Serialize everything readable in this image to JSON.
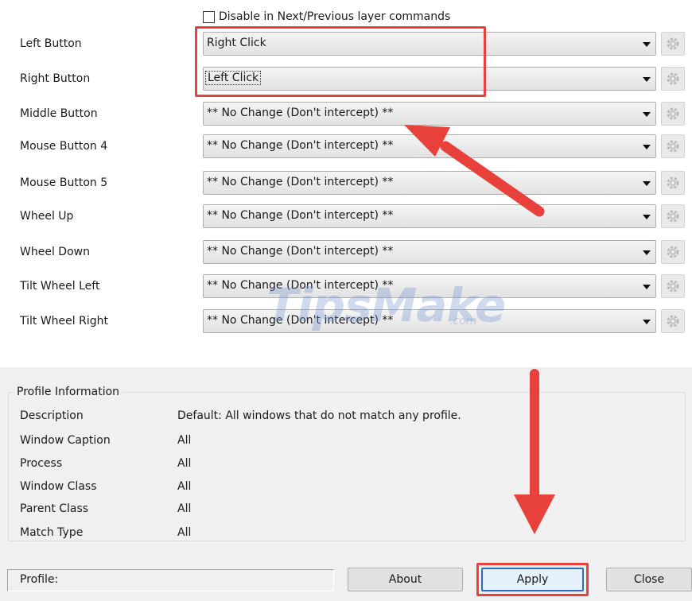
{
  "layer_option": {
    "label": "Disable in Next/Previous layer commands",
    "checked": false
  },
  "button_mappings": [
    {
      "label": "Left Button",
      "value": "Right Click"
    },
    {
      "label": "Right Button",
      "value": "Left Click"
    },
    {
      "label": "Middle Button",
      "value": "** No Change (Don't intercept) **"
    },
    {
      "label": "Mouse Button 4",
      "value": "** No Change (Don't intercept) **"
    },
    {
      "label": "Mouse Button 5",
      "value": "** No Change (Don't intercept) **"
    },
    {
      "label": "Wheel Up",
      "value": "** No Change (Don't intercept) **"
    },
    {
      "label": "Wheel Down",
      "value": "** No Change (Don't intercept) **"
    },
    {
      "label": "Tilt Wheel Left",
      "value": "** No Change (Don't intercept) **"
    },
    {
      "label": "Tilt Wheel Right",
      "value": "** No Change (Don't intercept) **"
    }
  ],
  "watermark": {
    "brand": "TipsMake",
    "domain": ".com"
  },
  "profile_info": {
    "title": "Profile Information",
    "rows": [
      {
        "label": "Description",
        "value": "Default: All windows that do not match any profile."
      },
      {
        "label": "Window Caption",
        "value": "All"
      },
      {
        "label": "Process",
        "value": "All"
      },
      {
        "label": "Window Class",
        "value": "All"
      },
      {
        "label": "Parent Class",
        "value": "All"
      },
      {
        "label": "Match Type",
        "value": "All"
      }
    ]
  },
  "status": {
    "profile_label": "Profile:",
    "profile_value": ""
  },
  "buttons": {
    "about": "About",
    "apply": "Apply",
    "close": "Close"
  },
  "icons": {
    "dropdown": "chevron-down-icon",
    "settings": "gear-icon",
    "annotation_arrow": "red-arrow-icon"
  },
  "colors": {
    "highlight": "#e8413b",
    "accent": "#2a6bc7"
  }
}
